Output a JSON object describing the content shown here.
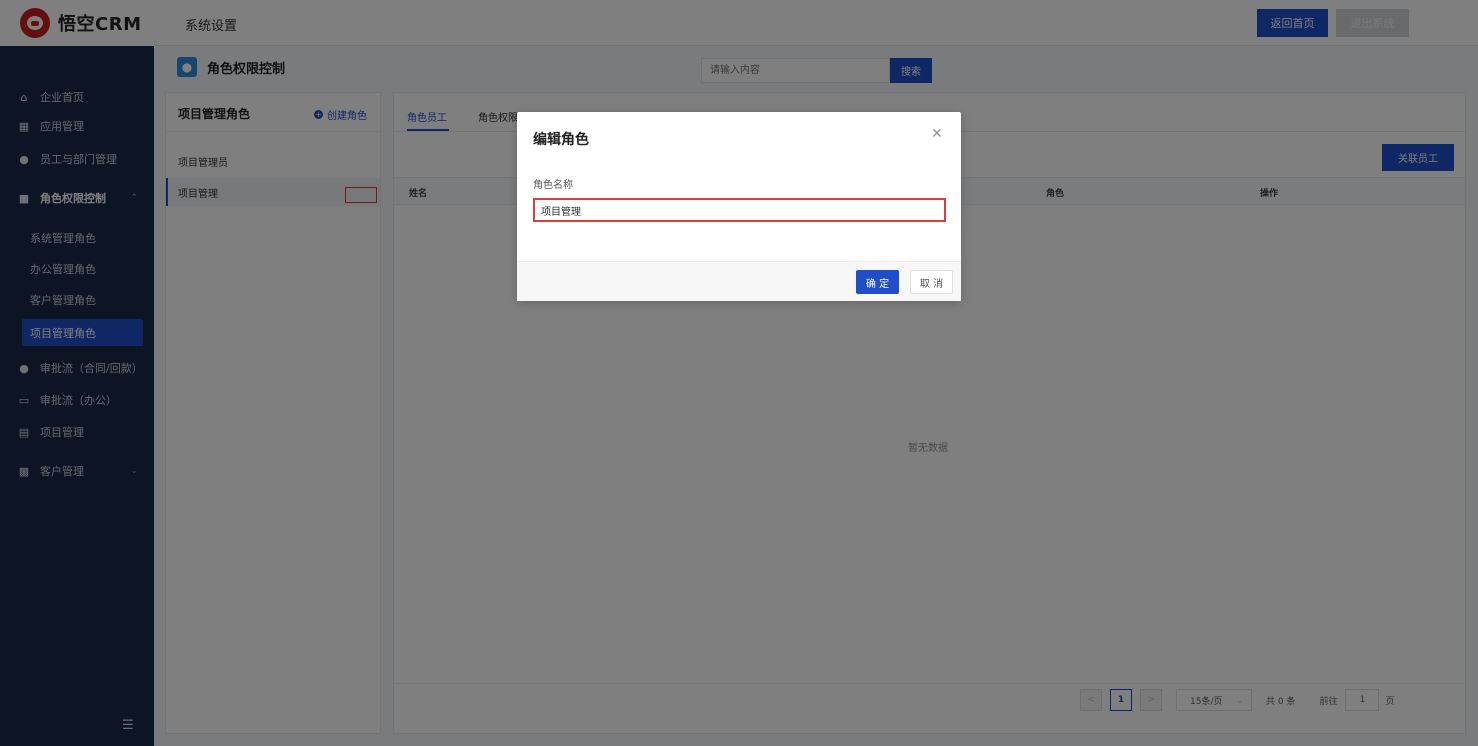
{
  "header": {
    "logo_text": "悟空CRM",
    "title": "系统设置",
    "home_button": "返回首页",
    "logout_button": "退出系统"
  },
  "sidebar": {
    "items": [
      {
        "label": "企业首页",
        "icon": "home-icon"
      },
      {
        "label": "应用管理",
        "icon": "grid-icon"
      },
      {
        "label": "员工与部门管理",
        "icon": "users-icon"
      },
      {
        "label": "角色权限控制",
        "icon": "role-icon"
      },
      {
        "label": "审批流（合同/回款）",
        "icon": "person-icon"
      },
      {
        "label": "审批流（办公）",
        "icon": "monitor-icon"
      },
      {
        "label": "项目管理",
        "icon": "project-icon"
      },
      {
        "label": "客户管理",
        "icon": "building-icon"
      }
    ],
    "sub_items": [
      "系统管理角色",
      "办公管理角色",
      "客户管理角色",
      "项目管理角色"
    ],
    "active_sub": "项目管理角色"
  },
  "page": {
    "title": "角色权限控制",
    "search_placeholder": "请输入内容",
    "search_button": "搜索"
  },
  "role_panel": {
    "title": "项目管理角色",
    "create_label": "创建角色",
    "roles": [
      "项目管理员",
      "项目管理"
    ]
  },
  "main_panel": {
    "tabs": [
      "角色员工",
      "角色权限"
    ],
    "associate_button": "关联员工",
    "columns": [
      "姓名",
      "角色",
      "操作"
    ],
    "empty_text": "暂无数据",
    "pagination": {
      "current_page": "1",
      "page_size": "15条/页",
      "total": "共 0 条",
      "goto_label": "前往",
      "goto_value": "1",
      "page_unit": "页"
    }
  },
  "dialog": {
    "title": "编辑角色",
    "field_label": "角色名称",
    "field_value": "项目管理",
    "ok_button": "确 定",
    "cancel_button": "取 消"
  }
}
